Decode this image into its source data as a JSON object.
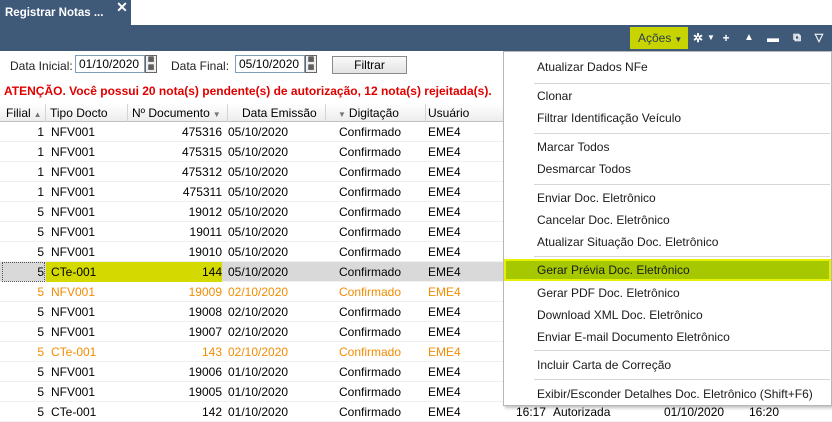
{
  "tab": {
    "title": "Registrar Notas ...",
    "close": "✕"
  },
  "toolbar": {
    "acoes_label": "Ações"
  },
  "filters": {
    "data_inicial_label": "Data Inicial:",
    "data_inicial_value": "01/10/2020",
    "data_final_label": "Data Final:",
    "data_final_value": "05/10/2020",
    "filtrar_label": "Filtrar"
  },
  "warning": "ATENÇÃO. Você possui 20 nota(s) pendente(s) de autorização, 12 nota(s) rejeitada(s).",
  "grid": {
    "columns": [
      "Filial",
      "Tipo Docto",
      "Nº Documento",
      "Data Emissão",
      "Digitação",
      "Usuário"
    ],
    "rows": [
      {
        "filial": "1",
        "tipo": "NFV001",
        "numero": "475316",
        "data": "05/10/2020",
        "digitacao": "Confirmado",
        "usuario": "EME4"
      },
      {
        "filial": "1",
        "tipo": "NFV001",
        "numero": "475315",
        "data": "05/10/2020",
        "digitacao": "Confirmado",
        "usuario": "EME4"
      },
      {
        "filial": "1",
        "tipo": "NFV001",
        "numero": "475312",
        "data": "05/10/2020",
        "digitacao": "Confirmado",
        "usuario": "EME4"
      },
      {
        "filial": "1",
        "tipo": "NFV001",
        "numero": "475311",
        "data": "05/10/2020",
        "digitacao": "Confirmado",
        "usuario": "EME4"
      },
      {
        "filial": "5",
        "tipo": "NFV001",
        "numero": "19012",
        "data": "05/10/2020",
        "digitacao": "Confirmado",
        "usuario": "EME4"
      },
      {
        "filial": "5",
        "tipo": "NFV001",
        "numero": "19011",
        "data": "05/10/2020",
        "digitacao": "Confirmado",
        "usuario": "EME4"
      },
      {
        "filial": "5",
        "tipo": "NFV001",
        "numero": "19010",
        "data": "05/10/2020",
        "digitacao": "Confirmado",
        "usuario": "EME4"
      },
      {
        "filial": "5",
        "tipo": "CTe-001",
        "numero": "144",
        "data": "05/10/2020",
        "digitacao": "Confirmado",
        "usuario": "EME4"
      },
      {
        "filial": "5",
        "tipo": "NFV001",
        "numero": "19009",
        "data": "02/10/2020",
        "digitacao": "Confirmado",
        "usuario": "EME4"
      },
      {
        "filial": "5",
        "tipo": "NFV001",
        "numero": "19008",
        "data": "02/10/2020",
        "digitacao": "Confirmado",
        "usuario": "EME4"
      },
      {
        "filial": "5",
        "tipo": "NFV001",
        "numero": "19007",
        "data": "02/10/2020",
        "digitacao": "Confirmado",
        "usuario": "EME4"
      },
      {
        "filial": "5",
        "tipo": "CTe-001",
        "numero": "143",
        "data": "02/10/2020",
        "digitacao": "Confirmado",
        "usuario": "EME4"
      },
      {
        "filial": "5",
        "tipo": "NFV001",
        "numero": "19006",
        "data": "01/10/2020",
        "digitacao": "Confirmado",
        "usuario": "EME4"
      },
      {
        "filial": "5",
        "tipo": "NFV001",
        "numero": "19005",
        "data": "01/10/2020",
        "digitacao": "Confirmado",
        "usuario": "EME4"
      },
      {
        "filial": "5",
        "tipo": "CTe-001",
        "numero": "142",
        "data": "01/10/2020",
        "digitacao": "Confirmado",
        "usuario": "EME4"
      }
    ],
    "last_row_extra": {
      "hora": "16:17",
      "status": "Autorizada",
      "data": "01/10/2020",
      "hora2": "16:20"
    }
  },
  "menu": {
    "items": [
      "Atualizar Dados NFe",
      "Clonar",
      "Filtrar Identificação Veículo",
      "Marcar Todos",
      "Desmarcar Todos",
      "Enviar Doc. Eletrônico",
      "Cancelar Doc. Eletrônico",
      "Atualizar Situação Doc. Eletrônico",
      "Gerar Prévia Doc. Eletrônico",
      "Gerar PDF Doc. Eletrônico",
      "Download XML Doc. Eletrônico",
      "Enviar E-mail Documento Eletrônico",
      "Incluir Carta de Correção",
      "Exibir/Esconder Detalhes Doc. Eletrônico (Shift+F6)"
    ]
  },
  "colors": {
    "header_bar": "#3f5a79",
    "accent": "#c8d400",
    "pending_row": "#f28c00",
    "selected_row": "#d9d9d9",
    "selected_cells": "#d4da00",
    "warning": "#e00000"
  },
  "icons": [
    "settings-gear-icon",
    "add-icon",
    "move-up-icon",
    "minimize-icon",
    "restore-icon",
    "filter-icon",
    "calendar-icon"
  ]
}
